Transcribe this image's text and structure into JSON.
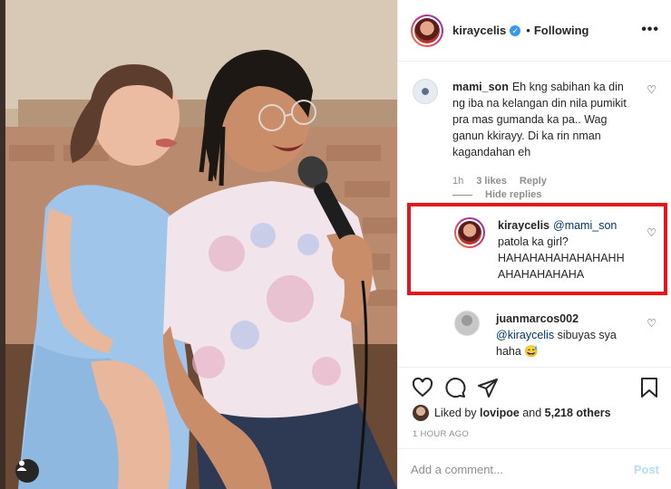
{
  "post": {
    "username": "kiraycelis",
    "following_label": "Following",
    "more_icon": "more-horizontal-icon",
    "liked_by_prefix": "Liked by",
    "liked_by_user": "lovipoe",
    "liked_by_and": "and",
    "likes_count": "5,218 others",
    "time_ago": "1 HOUR AGO"
  },
  "comments": [
    {
      "username": "mami_son",
      "text": "Eh kng sabihan ka din ng iba na kelangan din nila pumikit pra mas gumanda ka pa.. Wag ganun kkirayy. Di ka rin nman kagandahan eh",
      "time": "1h",
      "likes": "3 likes",
      "reply_label": "Reply"
    }
  ],
  "hide_replies_label": "Hide replies",
  "replies": [
    {
      "username": "kiraycelis",
      "mention": "@mami_son",
      "text": "patola ka girl? HAHAHAHAHAHAHAHH AHAHAHAHAHA"
    },
    {
      "username": "juanmarcos002",
      "mention": "@kiraycelis",
      "text": "sibuyas sya haha",
      "emoji": "😅"
    }
  ],
  "add_comment": {
    "placeholder": "Add a comment...",
    "post_label": "Post"
  },
  "colors": {
    "verified": "#3897f0",
    "highlight_border": "#e8141c",
    "mention": "#00376b",
    "post_disabled": "#b2dffc"
  }
}
